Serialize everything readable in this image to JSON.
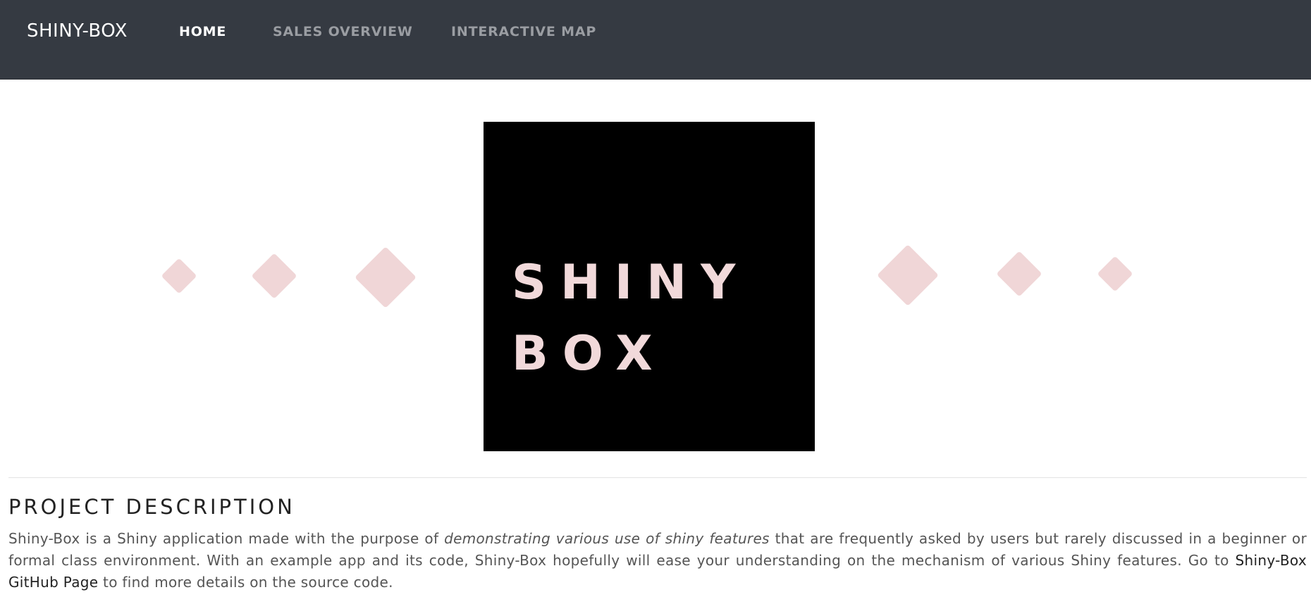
{
  "navbar": {
    "brand": "SHINY-BOX",
    "links": [
      {
        "label": "HOME",
        "active": true
      },
      {
        "label": "SALES OVERVIEW",
        "active": false
      },
      {
        "label": "INTERACTIVE MAP",
        "active": false
      }
    ]
  },
  "hero": {
    "logo_line1": "SHINY",
    "logo_line2": "BOX"
  },
  "section": {
    "title": "PROJECT DESCRIPTION",
    "text_1": "Shiny-Box is a Shiny application made with the purpose of ",
    "text_emphasis": "demonstrating various use of shiny features",
    "text_2": " that are frequently asked by users but rarely discussed in a beginner or formal class environment. With an example app and its code, Shiny-Box hopefully will ease your understanding on the mechanism of various Shiny features. Go to ",
    "link_label": "Shiny-Box GitHub Page",
    "text_3": " to find more details on the source code."
  },
  "colors": {
    "navbar_bg": "#353a42",
    "accent_pink": "#f0d6d7",
    "logo_bg": "#000000"
  }
}
